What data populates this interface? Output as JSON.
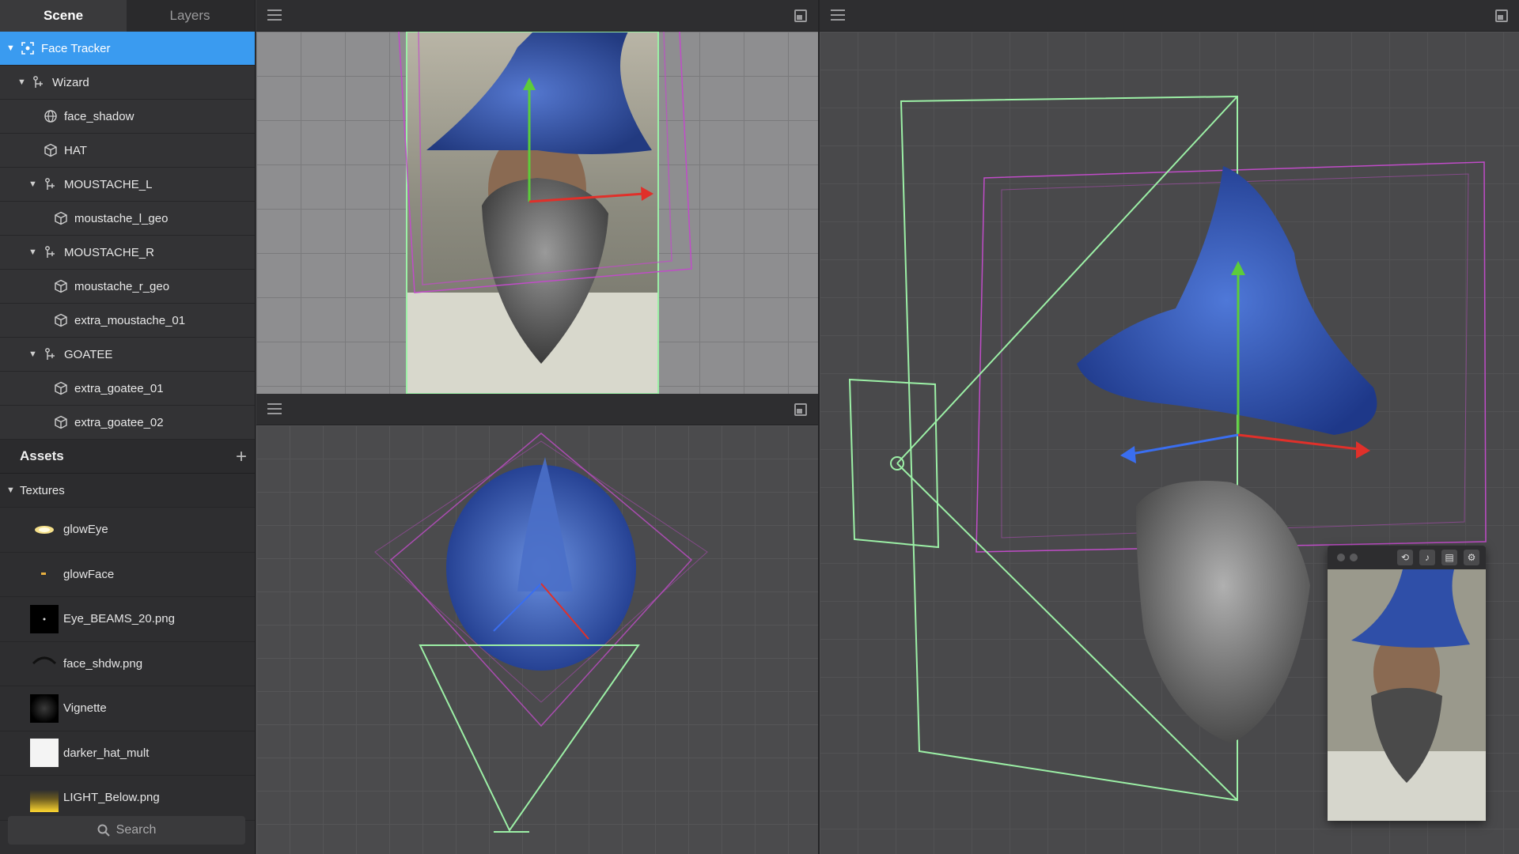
{
  "tabs": [
    {
      "label": "Scene"
    },
    {
      "label": "Layers"
    }
  ],
  "scene_tree": [
    {
      "label": "Face Tracker",
      "icon": "face-tracker-icon",
      "depth": 0,
      "arrow": true,
      "selected": true
    },
    {
      "label": "Wizard",
      "icon": "null-object-icon",
      "depth": 1,
      "arrow": true
    },
    {
      "label": "face_shadow",
      "icon": "globe-icon",
      "depth": 2,
      "arrow": false
    },
    {
      "label": "HAT",
      "icon": "cube-icon",
      "depth": 2,
      "arrow": false
    },
    {
      "label": "MOUSTACHE_L",
      "icon": "null-object-icon",
      "depth": 2,
      "arrow": true
    },
    {
      "label": "moustache_l_geo",
      "icon": "cube-icon",
      "depth": 3,
      "arrow": false
    },
    {
      "label": "MOUSTACHE_R",
      "icon": "null-object-icon",
      "depth": 2,
      "arrow": true
    },
    {
      "label": "moustache_r_geo",
      "icon": "cube-icon",
      "depth": 3,
      "arrow": false
    },
    {
      "label": "extra_moustache_01",
      "icon": "cube-icon",
      "depth": 3,
      "arrow": false
    },
    {
      "label": "GOATEE",
      "icon": "null-object-icon",
      "depth": 2,
      "arrow": true
    },
    {
      "label": "extra_goatee_01",
      "icon": "cube-icon",
      "depth": 3,
      "arrow": false
    },
    {
      "label": "extra_goatee_02",
      "icon": "cube-icon",
      "depth": 3,
      "arrow": false
    }
  ],
  "assets": {
    "title": "Assets",
    "add_icon": "plus-icon",
    "group_label": "Textures",
    "textures": [
      {
        "label": "glowEye",
        "thumb": "glow-yellow"
      },
      {
        "label": "glowFace",
        "thumb": "glow-small"
      },
      {
        "label": "Eye_BEAMS_20.png",
        "thumb": "black-dot"
      },
      {
        "label": "face_shdw.png",
        "thumb": "dark-arc"
      },
      {
        "label": "Vignette",
        "thumb": "vignette"
      },
      {
        "label": "darker_hat_mult",
        "thumb": "white"
      },
      {
        "label": "LIGHT_Below.png",
        "thumb": "yellow-gradient"
      }
    ]
  },
  "search": {
    "label": "Search",
    "icon": "search-icon"
  },
  "colors": {
    "selection": "#3a9bf0",
    "camera_frustum": "#9cf0a6",
    "bounding_box": "#c04cc8",
    "axis_x": "#e0302a",
    "axis_y": "#5ccc3a",
    "axis_z": "#3a6ef0",
    "hat_blue": "#2f4fa8"
  },
  "preview": {
    "buttons": [
      "rotate-icon",
      "audio-icon",
      "layout-icon",
      "settings-icon"
    ]
  }
}
